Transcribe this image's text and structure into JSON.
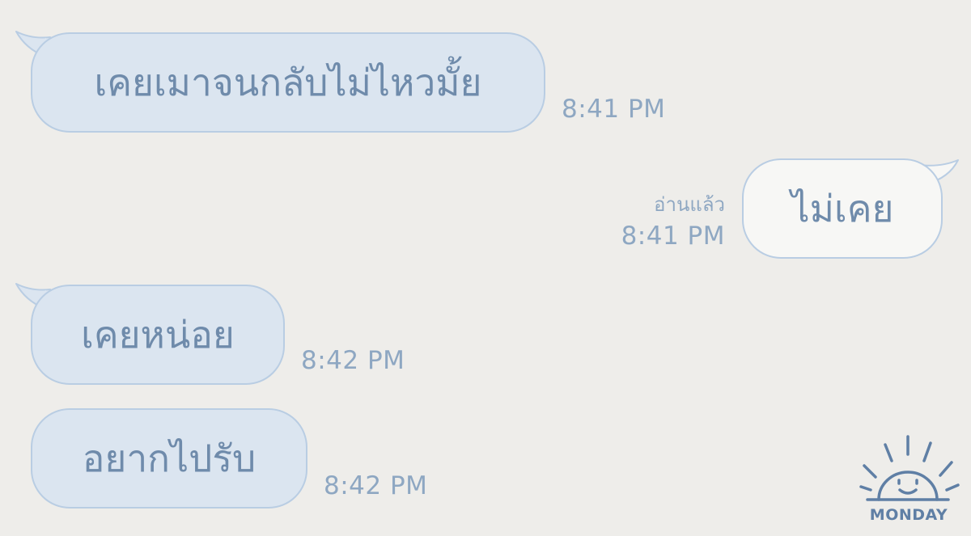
{
  "theme": {
    "background": "#eeedea",
    "incoming_bubble": "#dbe5f0",
    "outgoing_bubble": "#f7f7f5",
    "bubble_border": "#b9cde3",
    "text": "#6f8bab",
    "meta_text": "#8ea7c2"
  },
  "messages": [
    {
      "direction": "incoming",
      "text": "เคยเมาจนกลับไม่ไหวมั้ย",
      "time": "8:41 PM"
    },
    {
      "direction": "outgoing",
      "text": "ไม่เคย",
      "read_label": "อ่านแล้ว",
      "time": "8:41 PM"
    },
    {
      "direction": "incoming",
      "text": "เคยหน่อย",
      "time": "8:42 PM"
    },
    {
      "direction": "incoming",
      "text": "อยากไปรับ",
      "time": "8:42 PM"
    }
  ],
  "watermark": {
    "icon": "sun-icon",
    "text": "MONDAY"
  }
}
